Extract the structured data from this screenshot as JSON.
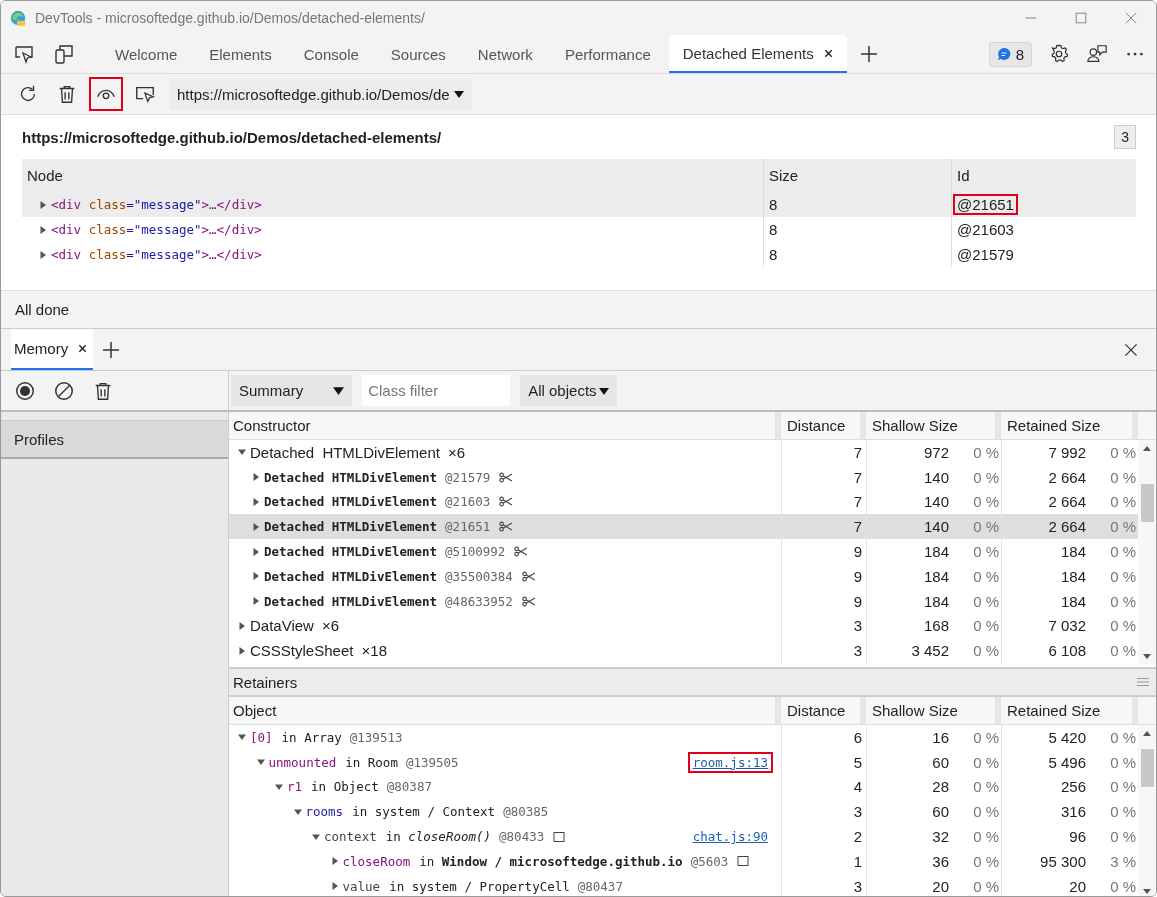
{
  "window": {
    "title": "DevTools - microsoftedge.github.io/Demos/detached-elements/"
  },
  "tabs": [
    {
      "label": "Welcome",
      "selected": false
    },
    {
      "label": "Elements",
      "selected": false
    },
    {
      "label": "Console",
      "selected": false
    },
    {
      "label": "Sources",
      "selected": false
    },
    {
      "label": "Network",
      "selected": false
    },
    {
      "label": "Performance",
      "selected": false
    },
    {
      "label": "Detached Elements",
      "selected": true
    }
  ],
  "issues_badge": {
    "count": "8"
  },
  "toolbar": {
    "buttons": [
      {
        "kind": "refresh",
        "highlighted": false
      },
      {
        "kind": "trash",
        "highlighted": false
      },
      {
        "kind": "eye",
        "highlighted": true
      },
      {
        "kind": "inspect",
        "highlighted": false
      }
    ],
    "url_select": "https://microsoftedge.github.io/Demos/de"
  },
  "detached": {
    "url": "https://microsoftedge.github.io/Demos/detached-elements/",
    "count": "3",
    "columns": [
      "Node",
      "Size",
      "Id"
    ],
    "rows": [
      {
        "node": [
          {
            "kind": "tag",
            "text": "<div"
          },
          {
            "kind": "attr",
            "text": " class"
          },
          {
            "kind": "value",
            "text": "=\"message\""
          },
          {
            "kind": "tag",
            "text": ">…</div>"
          }
        ],
        "size": "8",
        "id": "@21651",
        "selected": true,
        "id_highlighted": true
      },
      {
        "node": [
          {
            "kind": "tag",
            "text": "<div"
          },
          {
            "kind": "attr",
            "text": " class"
          },
          {
            "kind": "value",
            "text": "=\"message\""
          },
          {
            "kind": "tag",
            "text": ">…</div>"
          }
        ],
        "size": "8",
        "id": "@21603",
        "selected": false,
        "id_highlighted": false
      },
      {
        "node": [
          {
            "kind": "tag",
            "text": "<div"
          },
          {
            "kind": "attr",
            "text": " class"
          },
          {
            "kind": "value",
            "text": "=\"message\""
          },
          {
            "kind": "tag",
            "text": ">…</div>"
          }
        ],
        "size": "8",
        "id": "@21579",
        "selected": false,
        "id_highlighted": false
      }
    ]
  },
  "status": "All done",
  "drawer": {
    "tabs": [
      {
        "label": "Memory",
        "selected": true
      }
    ]
  },
  "memory": {
    "toolbar": {
      "view": "Summary",
      "filter_placeholder": "Class filter",
      "scope": "All objects"
    },
    "sidebar": [
      {
        "label": "Profiles",
        "selected": true
      }
    ],
    "constructors": {
      "columns": [
        "Constructor",
        "Distance",
        "Shallow Size",
        "Retained Size"
      ],
      "rows": [
        {
          "kind": "group",
          "name": "Detached HTMLDivElement ×6",
          "expanded": true,
          "selected": false,
          "distance": "7",
          "shallow": "972",
          "shallow_pct": "0 %",
          "retained": "7 992",
          "retained_pct": "0 %",
          "children": [
            {
              "kind": "object",
              "name": "Detached HTMLDivElement",
              "id": "@21579",
              "detached": true,
              "expanded": false,
              "selected": false,
              "distance": "7",
              "shallow": "140",
              "shallow_pct": "0 %",
              "retained": "2 664",
              "retained_pct": "0 %"
            },
            {
              "kind": "object",
              "name": "Detached HTMLDivElement",
              "id": "@21603",
              "detached": true,
              "expanded": false,
              "selected": false,
              "distance": "7",
              "shallow": "140",
              "shallow_pct": "0 %",
              "retained": "2 664",
              "retained_pct": "0 %"
            },
            {
              "kind": "object",
              "name": "Detached HTMLDivElement",
              "id": "@21651",
              "detached": true,
              "expanded": false,
              "selected": true,
              "distance": "7",
              "shallow": "140",
              "shallow_pct": "0 %",
              "retained": "2 664",
              "retained_pct": "0 %"
            },
            {
              "kind": "object",
              "name": "Detached HTMLDivElement",
              "id": "@5100992",
              "detached": true,
              "expanded": false,
              "selected": false,
              "distance": "9",
              "shallow": "184",
              "shallow_pct": "0 %",
              "retained": "184",
              "retained_pct": "0 %"
            },
            {
              "kind": "object",
              "name": "Detached HTMLDivElement",
              "id": "@35500384",
              "detached": true,
              "expanded": false,
              "selected": false,
              "distance": "9",
              "shallow": "184",
              "shallow_pct": "0 %",
              "retained": "184",
              "retained_pct": "0 %"
            },
            {
              "kind": "object",
              "name": "Detached HTMLDivElement",
              "id": "@48633952",
              "detached": true,
              "expanded": false,
              "selected": false,
              "distance": "9",
              "shallow": "184",
              "shallow_pct": "0 %",
              "retained": "184",
              "retained_pct": "0 %"
            }
          ]
        },
        {
          "kind": "group",
          "name": "DataView ×6",
          "expanded": false,
          "selected": false,
          "distance": "3",
          "shallow": "168",
          "shallow_pct": "0 %",
          "retained": "7 032",
          "retained_pct": "0 %"
        },
        {
          "kind": "group",
          "name": "CSSStyleSheet ×18",
          "expanded": false,
          "selected": false,
          "distance": "3",
          "shallow": "3 452",
          "shallow_pct": "0 %",
          "retained": "6 108",
          "retained_pct": "0 %"
        }
      ]
    },
    "retainers": {
      "title": "Retainers",
      "columns": [
        "Object",
        "Distance",
        "Shallow Size",
        "Retained Size"
      ],
      "rows": [
        {
          "name": "[0]",
          "color": "#881280",
          "holder": "in Array",
          "id": "@139513",
          "expanded": true,
          "distance": "6",
          "shallow": "16",
          "shallow_pct": "0 %",
          "retained": "5 420",
          "retained_pct": "0 %",
          "children": [
            {
              "name": "unmounted",
              "color": "#881280",
              "holder": "in Room",
              "id": "@139505",
              "link": "room.js:13",
              "link_highlighted": true,
              "expanded": true,
              "distance": "5",
              "shallow": "60",
              "shallow_pct": "0 %",
              "retained": "5 496",
              "retained_pct": "0 %",
              "children": [
                {
                  "name": "r1",
                  "color": "#881280",
                  "holder": "in Object",
                  "id": "@80387",
                  "expanded": true,
                  "distance": "4",
                  "shallow": "28",
                  "shallow_pct": "0 %",
                  "retained": "256",
                  "retained_pct": "0 %",
                  "children": [
                    {
                      "name": "rooms",
                      "color": "#1a1aa6",
                      "holder": "in system / Context",
                      "id": "@80385",
                      "expanded": true,
                      "distance": "3",
                      "shallow": "60",
                      "shallow_pct": "0 %",
                      "retained": "316",
                      "retained_pct": "0 %",
                      "children": [
                        {
                          "name": "context",
                          "color": "#444444",
                          "holder": "in *closeRoom()*",
                          "id": "@80433",
                          "reveal_icon": true,
                          "link": "chat.js:90",
                          "link_highlighted": false,
                          "expanded": true,
                          "distance": "2",
                          "shallow": "32",
                          "shallow_pct": "0 %",
                          "retained": "96",
                          "retained_pct": "0 %",
                          "children": [
                            {
                              "name": "closeRoom",
                              "color": "#881280",
                              "holder": "in **Window / microsoftedge.github.io**",
                              "id": "@5603",
                              "reveal_icon": true,
                              "expanded": false,
                              "distance": "1",
                              "shallow": "36",
                              "shallow_pct": "0 %",
                              "retained": "95 300",
                              "retained_pct": "3 %"
                            },
                            {
                              "name": "value",
                              "color": "#444444",
                              "holder": "in system / PropertyCell",
                              "id": "@80437",
                              "expanded": false,
                              "distance": "3",
                              "shallow": "20",
                              "shallow_pct": "0 %",
                              "retained": "20",
                              "retained_pct": "0 %"
                            }
                          ]
                        }
                      ]
                    }
                  ]
                }
              ]
            }
          ]
        }
      ]
    }
  }
}
